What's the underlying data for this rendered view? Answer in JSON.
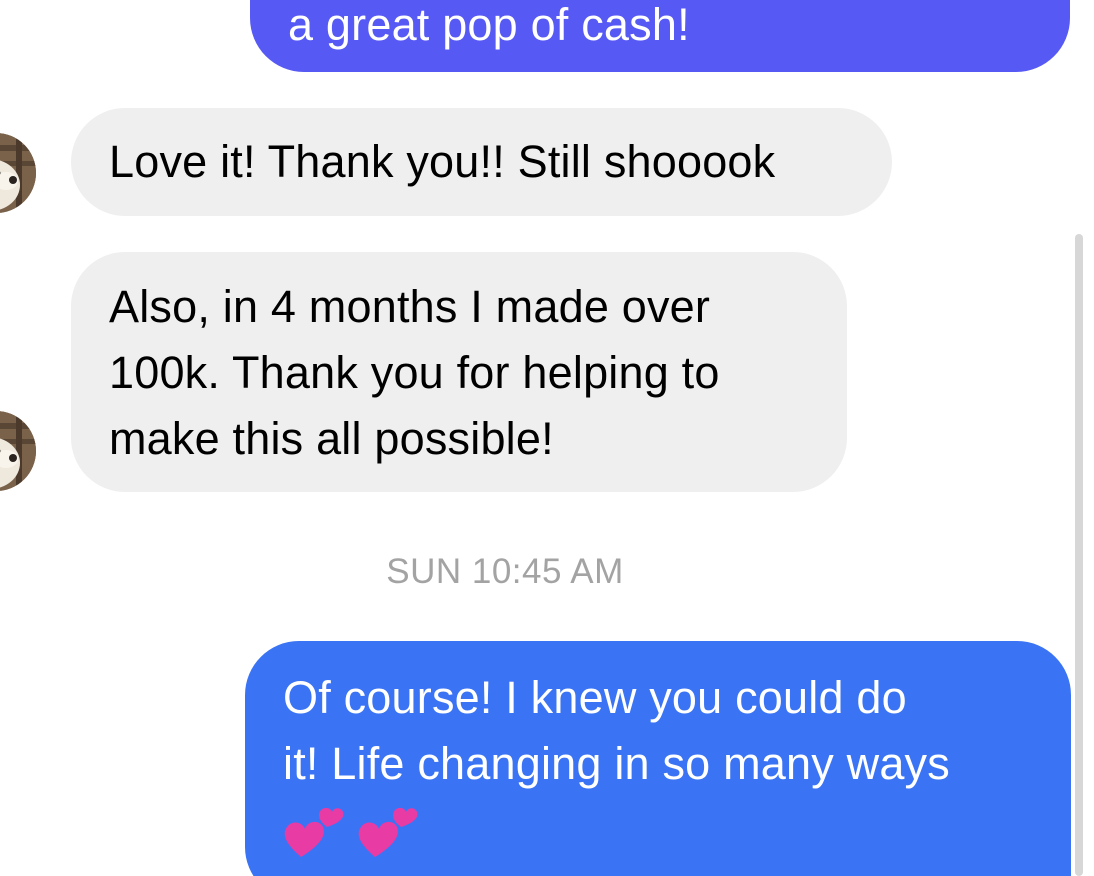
{
  "conversation": {
    "messages": [
      {
        "direction": "outgoing",
        "text": "a great pop of cash!"
      },
      {
        "direction": "incoming",
        "text": "Love it! Thank you!! Still shooook"
      },
      {
        "direction": "incoming",
        "lines": [
          "Also, in 4 months I made over",
          "100k. Thank you for helping to",
          "make this all possible!"
        ]
      },
      {
        "direction": "outgoing",
        "lines": [
          "Of course! I knew you could do",
          "it! Life changing in so many ways"
        ],
        "emoji": [
          "two-hearts-emoji",
          "two-hearts-emoji"
        ]
      }
    ],
    "timestamp": "SUN 10:45 AM"
  },
  "colors": {
    "outgoing_top": "#5759f4",
    "outgoing_bottom": "#3a74f4",
    "incoming": "#efefef",
    "timestamp": "#a3a3a3"
  }
}
